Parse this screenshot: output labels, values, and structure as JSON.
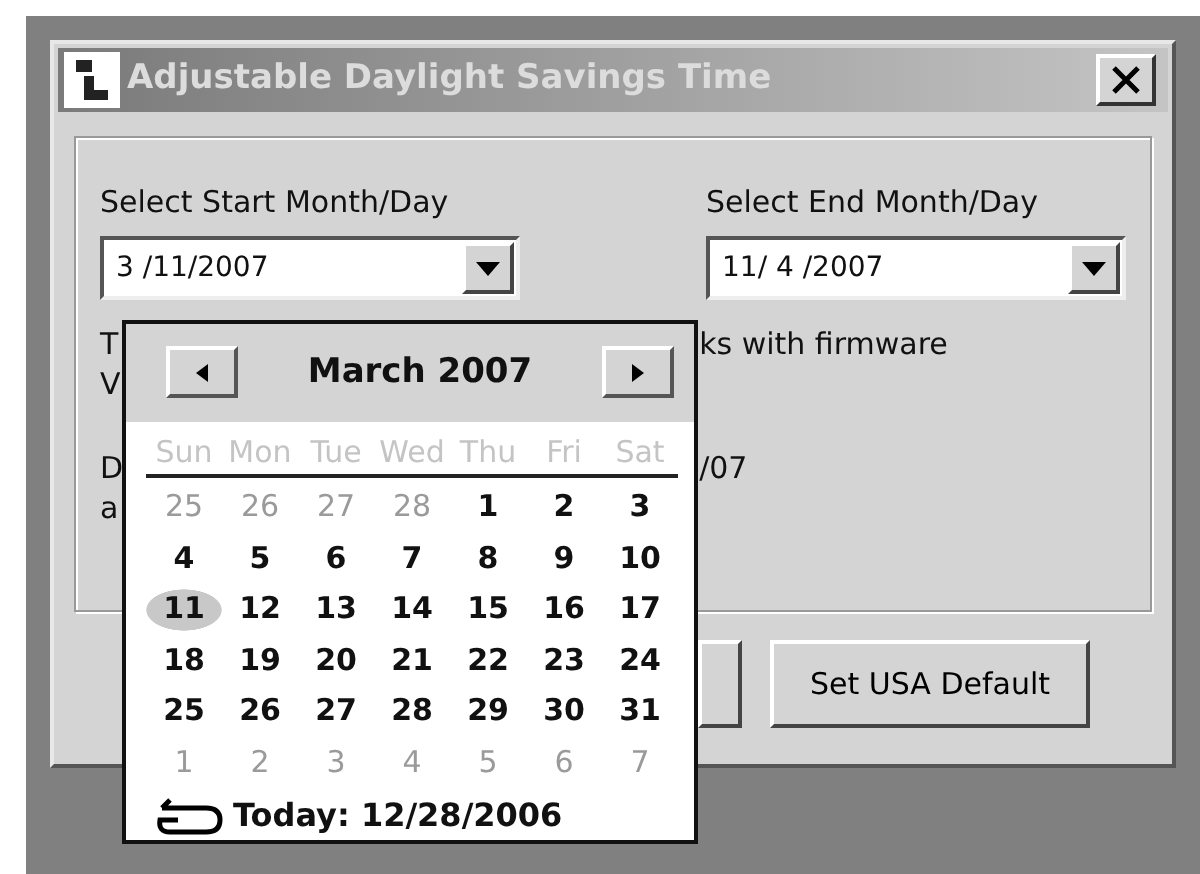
{
  "window": {
    "title": "Adjustable Daylight Savings Time"
  },
  "start": {
    "label": "Select Start Month/Day",
    "value": "3 /11/2007"
  },
  "end": {
    "label": "Select End Month/Day",
    "value": "11/ 4 /2007"
  },
  "left_fragments": [
    "T",
    "V",
    "D",
    "a"
  ],
  "right_fragments": [
    "ks with firmware",
    "/07"
  ],
  "buttons": [
    {
      "kind": "covered"
    },
    {
      "kind": "normal",
      "label": "Set USA Default"
    }
  ],
  "calendar": {
    "title": "March 2007",
    "weekdays": [
      "Sun",
      "Mon",
      "Tue",
      "Wed",
      "Thu",
      "Fri",
      "Sat"
    ],
    "weeks": [
      [
        {
          "day": "25",
          "in_month": false,
          "selected": false
        },
        {
          "day": "26",
          "in_month": false,
          "selected": false
        },
        {
          "day": "27",
          "in_month": false,
          "selected": false
        },
        {
          "day": "28",
          "in_month": false,
          "selected": false
        },
        {
          "day": "1",
          "in_month": true,
          "selected": false
        },
        {
          "day": "2",
          "in_month": true,
          "selected": false
        },
        {
          "day": "3",
          "in_month": true,
          "selected": false
        }
      ],
      [
        {
          "day": "4",
          "in_month": true,
          "selected": false
        },
        {
          "day": "5",
          "in_month": true,
          "selected": false
        },
        {
          "day": "6",
          "in_month": true,
          "selected": false
        },
        {
          "day": "7",
          "in_month": true,
          "selected": false
        },
        {
          "day": "8",
          "in_month": true,
          "selected": false
        },
        {
          "day": "9",
          "in_month": true,
          "selected": false
        },
        {
          "day": "10",
          "in_month": true,
          "selected": false
        }
      ],
      [
        {
          "day": "11",
          "in_month": true,
          "selected": true
        },
        {
          "day": "12",
          "in_month": true,
          "selected": false
        },
        {
          "day": "13",
          "in_month": true,
          "selected": false
        },
        {
          "day": "14",
          "in_month": true,
          "selected": false
        },
        {
          "day": "15",
          "in_month": true,
          "selected": false
        },
        {
          "day": "16",
          "in_month": true,
          "selected": false
        },
        {
          "day": "17",
          "in_month": true,
          "selected": false
        }
      ],
      [
        {
          "day": "18",
          "in_month": true,
          "selected": false
        },
        {
          "day": "19",
          "in_month": true,
          "selected": false
        },
        {
          "day": "20",
          "in_month": true,
          "selected": false
        },
        {
          "day": "21",
          "in_month": true,
          "selected": false
        },
        {
          "day": "22",
          "in_month": true,
          "selected": false
        },
        {
          "day": "23",
          "in_month": true,
          "selected": false
        },
        {
          "day": "24",
          "in_month": true,
          "selected": false
        }
      ],
      [
        {
          "day": "25",
          "in_month": true,
          "selected": false
        },
        {
          "day": "26",
          "in_month": true,
          "selected": false
        },
        {
          "day": "27",
          "in_month": true,
          "selected": false
        },
        {
          "day": "28",
          "in_month": true,
          "selected": false
        },
        {
          "day": "29",
          "in_month": true,
          "selected": false
        },
        {
          "day": "30",
          "in_month": true,
          "selected": false
        },
        {
          "day": "31",
          "in_month": true,
          "selected": false
        }
      ],
      [
        {
          "day": "1",
          "in_month": false,
          "selected": false
        },
        {
          "day": "2",
          "in_month": false,
          "selected": false
        },
        {
          "day": "3",
          "in_month": false,
          "selected": false
        },
        {
          "day": "4",
          "in_month": false,
          "selected": false
        },
        {
          "day": "5",
          "in_month": false,
          "selected": false
        },
        {
          "day": "6",
          "in_month": false,
          "selected": false
        },
        {
          "day": "7",
          "in_month": false,
          "selected": false
        }
      ]
    ],
    "today": "Today: 12/28/2006"
  }
}
